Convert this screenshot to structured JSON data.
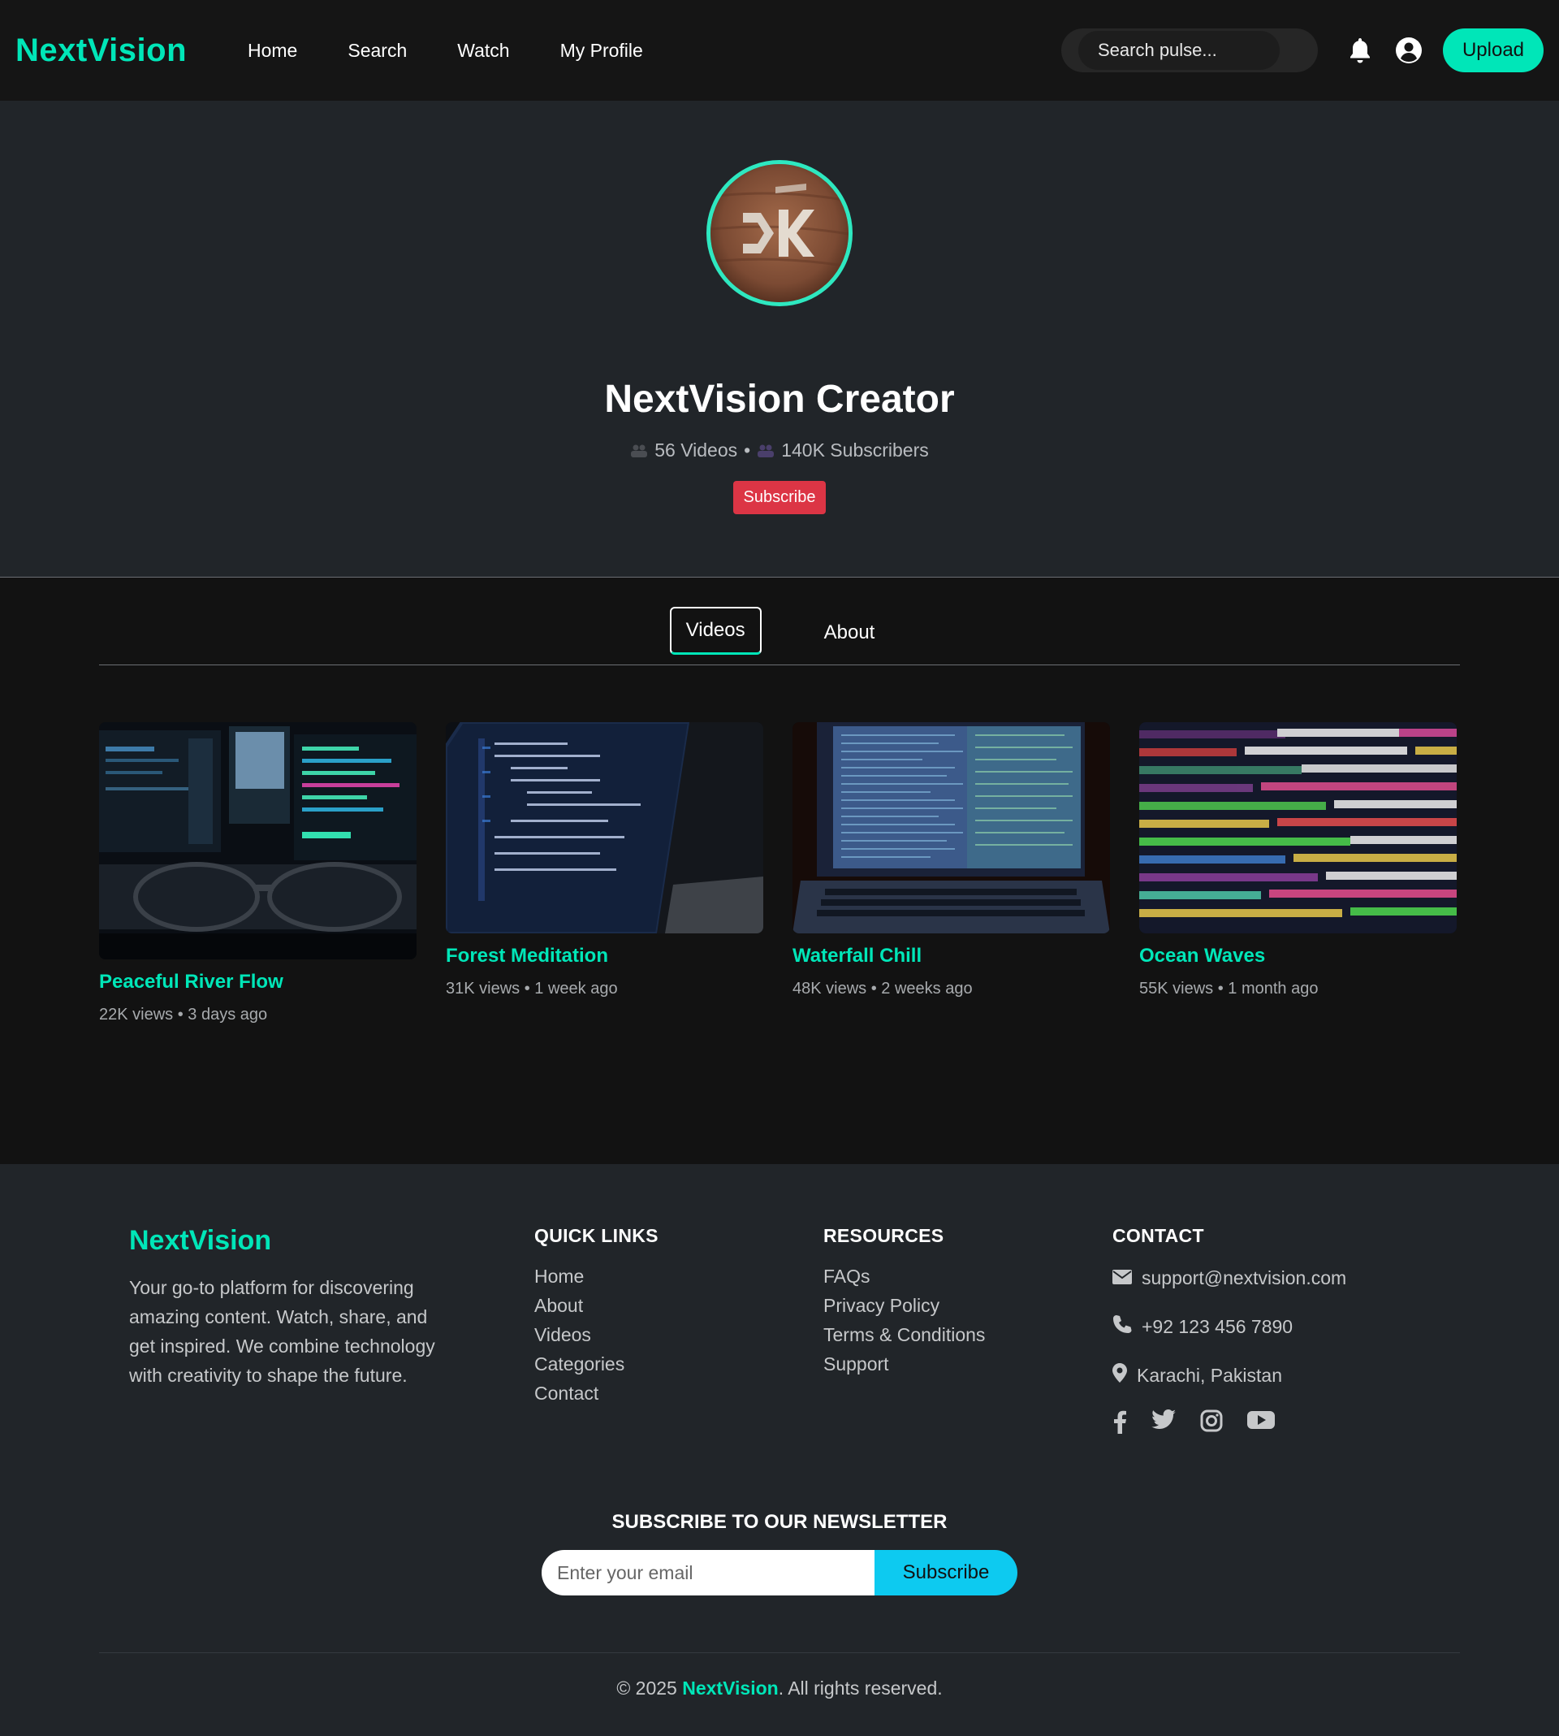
{
  "navbar": {
    "brand": "NextVision",
    "links": [
      "Home",
      "Search",
      "Watch",
      "My Profile"
    ],
    "search_placeholder": "Search pulse...",
    "upload_label": "Upload"
  },
  "profile": {
    "name": "NextVision Creator",
    "videos_count": "56 Videos",
    "separator": "•",
    "subscribers": "140K Subscribers",
    "subscribe_label": "Subscribe"
  },
  "tabs": [
    {
      "label": "Videos",
      "active": true
    },
    {
      "label": "About",
      "active": false
    }
  ],
  "videos": [
    {
      "title": "Peaceful River Flow",
      "meta": "22K views • 3 days ago"
    },
    {
      "title": "Forest Meditation",
      "meta": "31K views • 1 week ago"
    },
    {
      "title": "Waterfall Chill",
      "meta": "48K views • 2 weeks ago"
    },
    {
      "title": "Ocean Waves",
      "meta": "55K views • 1 month ago"
    }
  ],
  "footer": {
    "brand": "NextVision",
    "description": "Your go-to platform for discovering amazing content. Watch, share, and get inspired. We combine technology with creativity to shape the future.",
    "quick_links": {
      "heading": "QUICK LINKS",
      "items": [
        "Home",
        "About",
        "Videos",
        "Categories",
        "Contact"
      ]
    },
    "resources": {
      "heading": "RESOURCES",
      "items": [
        "FAQs",
        "Privacy Policy",
        "Terms & Conditions",
        "Support"
      ]
    },
    "contact": {
      "heading": "CONTACT",
      "email": "support@nextvision.com",
      "phone": "+92 123 456 7890",
      "location": "Karachi, Pakistan"
    },
    "socials": [
      "facebook-icon",
      "twitter-icon",
      "instagram-icon",
      "youtube-icon"
    ],
    "newsletter": {
      "heading": "SUBSCRIBE TO OUR NEWSLETTER",
      "placeholder": "Enter your email",
      "button": "Subscribe"
    },
    "copyright_prefix": "© 2025",
    "copyright_brand": "NextVision",
    "copyright_suffix": ". All rights reserved."
  },
  "colors": {
    "accent": "#00e6b8",
    "danger": "#dc3545",
    "info": "#0dcaf0",
    "nav_bg": "#151515",
    "page_bg": "#212529",
    "content_bg": "#121212"
  }
}
